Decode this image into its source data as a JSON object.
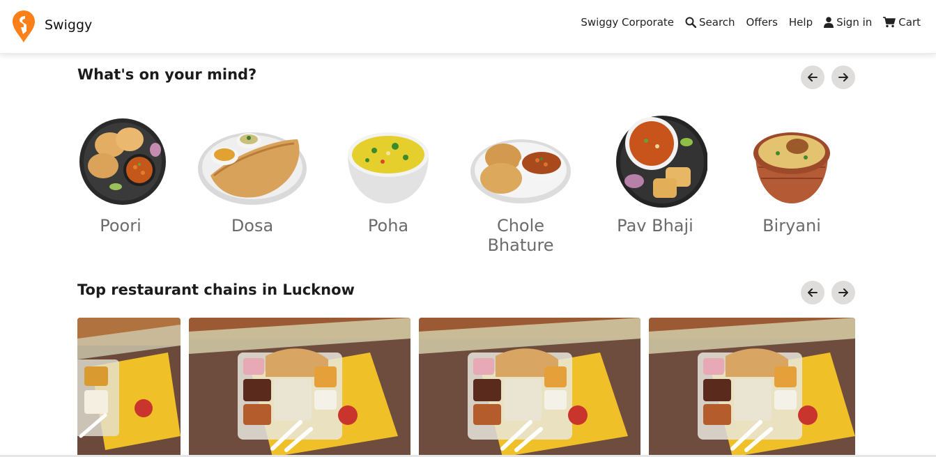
{
  "header": {
    "brand": "Swiggy",
    "nav": {
      "corporate": "Swiggy Corporate",
      "search": "Search",
      "offers": "Offers",
      "help": "Help",
      "signin": "Sign in",
      "cart": "Cart"
    }
  },
  "whats_on_mind": {
    "title": "What's on your mind?",
    "items": [
      {
        "label": "Poori"
      },
      {
        "label": "Dosa"
      },
      {
        "label": "Poha"
      },
      {
        "label": "Chole Bhature"
      },
      {
        "label": "Pav Bhaji"
      },
      {
        "label": "Biryani"
      }
    ]
  },
  "top_chains": {
    "title": "Top restaurant chains in Lucknow",
    "cards": 4
  },
  "colors": {
    "brand_orange": "#fc8019",
    "arrow_bg": "#dfdcdc"
  }
}
